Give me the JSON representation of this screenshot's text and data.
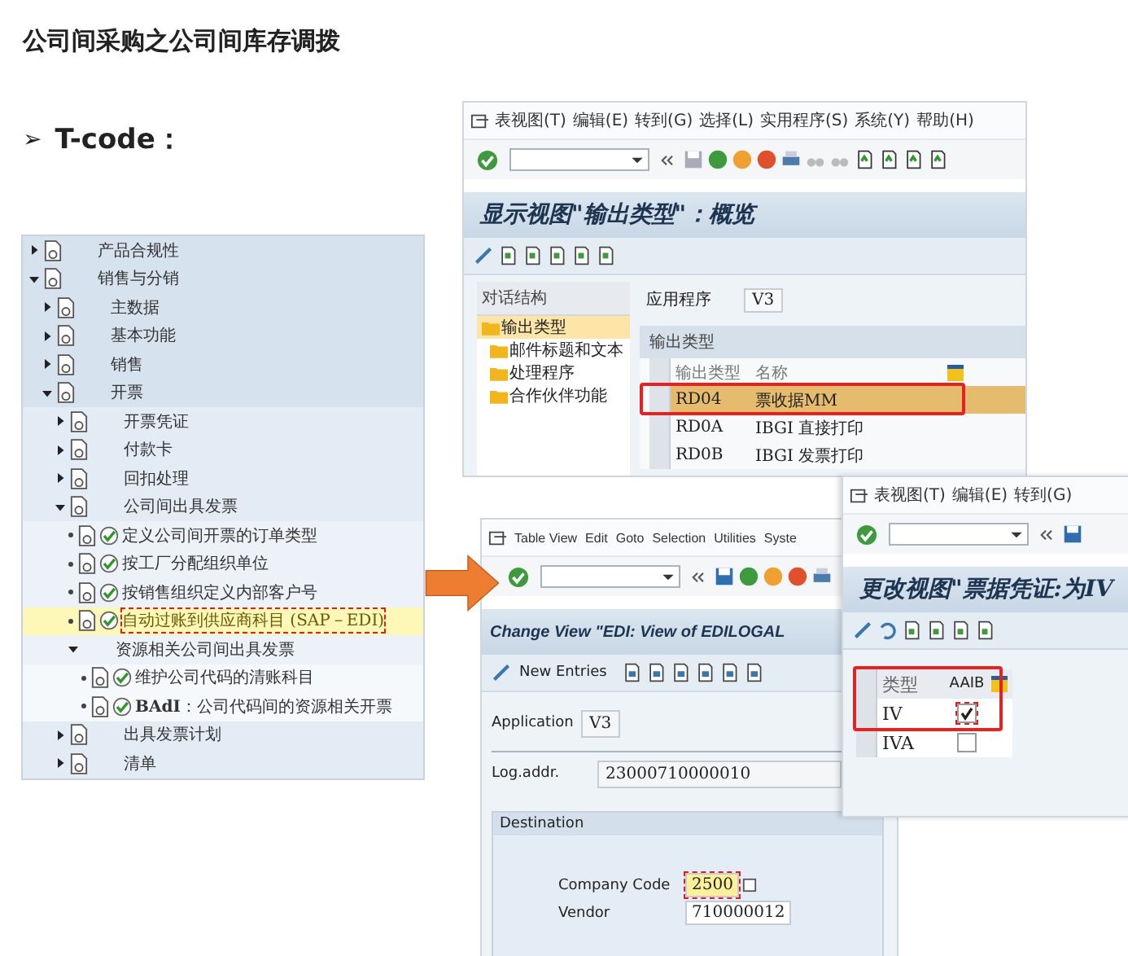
{
  "title": "公司间采购之公司间库存调拨",
  "bullet": {
    "marker": "➢",
    "text": "T-code："
  },
  "tree": [
    {
      "kind": "folder",
      "label": "产品合规性",
      "expanded": false
    },
    {
      "kind": "folder",
      "label": "销售与分销",
      "expanded": true,
      "children": [
        {
          "kind": "folder",
          "label": "主数据",
          "expanded": false
        },
        {
          "kind": "folder",
          "label": "基本功能",
          "expanded": false
        },
        {
          "kind": "folder",
          "label": "销售",
          "expanded": false
        },
        {
          "kind": "folder",
          "label": "开票",
          "expanded": true,
          "children": [
            {
              "kind": "folder",
              "label": "开票凭证",
              "expanded": false
            },
            {
              "kind": "folder",
              "label": "付款卡",
              "expanded": false
            },
            {
              "kind": "folder",
              "label": "回扣处理",
              "expanded": false
            },
            {
              "kind": "folder",
              "label": "公司间出具发票",
              "expanded": true,
              "children": [
                {
                  "kind": "activity",
                  "label": "定义公司间开票的订单类型",
                  "selected": false
                },
                {
                  "kind": "activity",
                  "label": "按工厂分配组织单位",
                  "selected": false
                },
                {
                  "kind": "activity",
                  "label": "按销售组织定义内部客户号",
                  "selected": false
                },
                {
                  "kind": "activity",
                  "label": "自动过账到供应商科目 (SAP－EDI)",
                  "selected": true
                },
                {
                  "kind": "group",
                  "label": "资源相关公司间出具发票",
                  "expanded": true,
                  "children": [
                    {
                      "kind": "activity",
                      "label": "维护公司代码的清账科目",
                      "selected": false
                    },
                    {
                      "kind": "activity",
                      "label": "**BAdI**：公司代码间的资源相关开票",
                      "selected": false
                    }
                  ]
                }
              ]
            },
            {
              "kind": "folder",
              "label": "出具发票计划",
              "expanded": false
            },
            {
              "kind": "folder",
              "label": "清单",
              "expanded": false
            }
          ]
        }
      ]
    }
  ],
  "output_types_window": {
    "menu": [
      "表视图(T)",
      "编辑(E)",
      "转到(G)",
      "选择(L)",
      "实用程序(S)",
      "系统(Y)",
      "帮助(H)"
    ],
    "title": "显示视图\"输出类型\"：概览",
    "dialog_structure": {
      "heading": "对话结构",
      "items": [
        {
          "label": "输出类型",
          "selected": true,
          "children": [
            {
              "label": "邮件标题和文本",
              "selected": false
            },
            {
              "label": "处理程序",
              "selected": false
            },
            {
              "label": "合作伙伴功能",
              "selected": false
            }
          ]
        }
      ]
    },
    "fields": [
      {
        "label": "应用程序",
        "value": "V3"
      }
    ],
    "table": {
      "title": "输出类型",
      "columns": [
        "输出类型",
        "名称"
      ],
      "rows": [
        {
          "cells": [
            "RD04",
            "票收据MM"
          ],
          "selected": true
        },
        {
          "cells": [
            "RD0A",
            "IBGI 直接打印"
          ],
          "selected": false
        },
        {
          "cells": [
            "RD0B",
            "IBGI 发票打印"
          ],
          "selected": false
        }
      ]
    }
  },
  "edi_window": {
    "menu": [
      "Table View",
      "Edit",
      "Goto",
      "Selection",
      "Utilities",
      "Syste"
    ],
    "title": "Change View \"EDI: View of EDILOGAL",
    "toolbar_button": "New Entries",
    "fields": [
      {
        "label": "Application",
        "value": "V3"
      },
      {
        "label": "Log.addr.",
        "value": "23000710000010"
      }
    ],
    "destination": {
      "heading": "Destination",
      "fields": [
        {
          "label": "Company Code",
          "value": "2500",
          "focused": true
        },
        {
          "label": "Vendor",
          "value": "710000012",
          "focused": false
        }
      ]
    }
  },
  "document_window": {
    "menu": [
      "表视图(T)",
      "编辑(E)",
      "转到(G)"
    ],
    "title": "更改视图\"票据凭证:为IV",
    "table": {
      "columns": [
        "类型",
        "AAIB"
      ],
      "rows": [
        {
          "type": "IV",
          "aaib": true
        },
        {
          "type": "IVA",
          "aaib": false
        }
      ]
    }
  }
}
